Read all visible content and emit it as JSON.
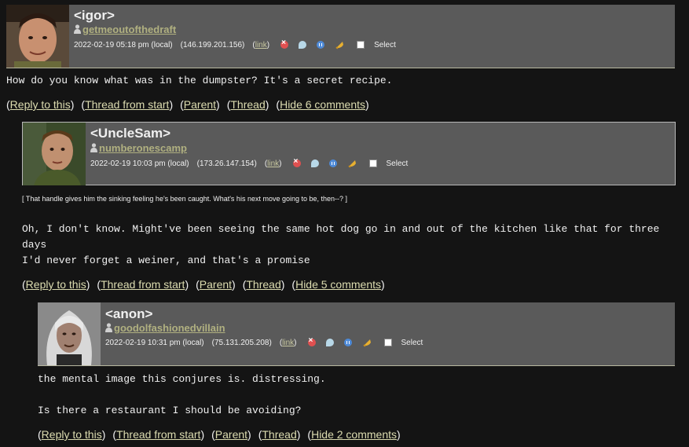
{
  "comments": [
    {
      "username": "<igor>",
      "account": "getmeoutofthedraft",
      "timestamp": "2022-02-19 05:18 pm (local)",
      "ip": "(146.199.201.156)",
      "link_label": "link",
      "select_label": "Select",
      "body": "How do you know what was in the dumpster? It's a secret recipe.",
      "actions": {
        "reply": "Reply to this",
        "thread_start": "Thread from start",
        "parent": "Parent",
        "thread": "Thread",
        "hide": "Hide 6 comments"
      }
    },
    {
      "username": "<UncleSam>",
      "account": "numberonescamp",
      "timestamp": "2022-02-19 10:03 pm (local)",
      "ip": "(173.26.147.154)",
      "link_label": "link",
      "select_label": "Select",
      "subject": "[ That handle gives him the sinking feeling he's been caught. What's his next move going to be, then--? ]",
      "body": "Oh, I don't know. Might've been seeing the same hot dog go in and out of the kitchen like that for three\ndays\nI'd never forget a weiner, and that's a promise",
      "actions": {
        "reply": "Reply to this",
        "thread_start": "Thread from start",
        "parent": "Parent",
        "thread": "Thread",
        "hide": "Hide 5 comments"
      }
    },
    {
      "username": "<anon>",
      "account": "goodolfashionedvillain",
      "timestamp": "2022-02-19 10:31 pm (local)",
      "ip": "(75.131.205.208)",
      "link_label": "link",
      "select_label": "Select",
      "body": "the mental image this conjures is. distressing.\n\nIs there a restaurant I should be avoiding?",
      "actions": {
        "reply": "Reply to this",
        "thread_start": "Thread from start",
        "parent": "Parent",
        "thread": "Thread",
        "hide": "Hide 2 comments"
      }
    }
  ]
}
